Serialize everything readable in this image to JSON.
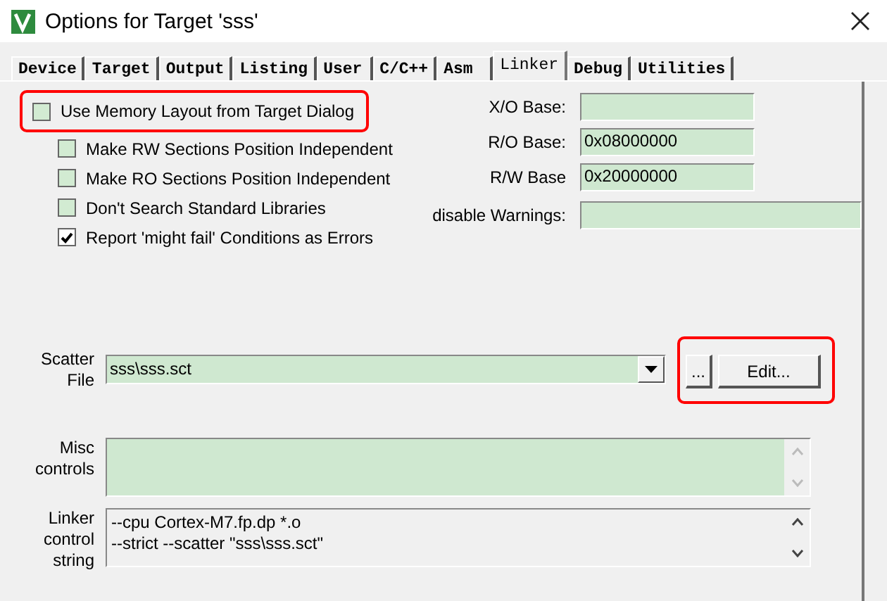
{
  "window": {
    "title": "Options for Target 'sss'"
  },
  "tabs": [
    {
      "label": "Device",
      "selected": false
    },
    {
      "label": "Target",
      "selected": false
    },
    {
      "label": "Output",
      "selected": false
    },
    {
      "label": "Listing",
      "selected": false
    },
    {
      "label": "User",
      "selected": false
    },
    {
      "label": "C/C++",
      "selected": false
    },
    {
      "label": "Asm",
      "selected": false
    },
    {
      "label": "Linker",
      "selected": true
    },
    {
      "label": "Debug",
      "selected": false
    },
    {
      "label": "Utilities",
      "selected": false
    }
  ],
  "options": [
    {
      "kind": "main",
      "label": "Use Memory Layout from Target Dialog",
      "checked": false,
      "highlighted": true
    },
    {
      "kind": "sub",
      "label": "Make RW Sections Position Independent",
      "checked": false,
      "highlighted": false
    },
    {
      "kind": "sub",
      "label": "Make RO Sections Position Independent",
      "checked": false,
      "highlighted": false
    },
    {
      "kind": "sub",
      "label": "Don't Search Standard Libraries",
      "checked": false,
      "highlighted": false
    },
    {
      "kind": "sub",
      "label": "Report 'might fail' Conditions as Errors",
      "checked": true,
      "highlighted": false
    }
  ],
  "address_fields": [
    {
      "kind": "address",
      "label": "X/O Base:"
    },
    {
      "kind": "address",
      "label": "R/O Base:",
      "value": "0x08000000"
    },
    {
      "kind": "address",
      "label": "R/W Base",
      "value": "0x20000000"
    },
    {
      "kind": "wide",
      "label": "disable Warnings:"
    }
  ],
  "scatter_file": {
    "label": "Scatter File",
    "value": "sss\\sss.sct",
    "browse_button": "...",
    "edit_button": "Edit...",
    "highlighted": true
  },
  "misc_controls": {
    "label": "Misc controls"
  },
  "linker_control_string": {
    "label": "Linker control string",
    "lines": [
      "--cpu Cortex-M7.fp.dp *.o",
      "--strict --scatter \"sss\\sss.sct\""
    ]
  }
}
